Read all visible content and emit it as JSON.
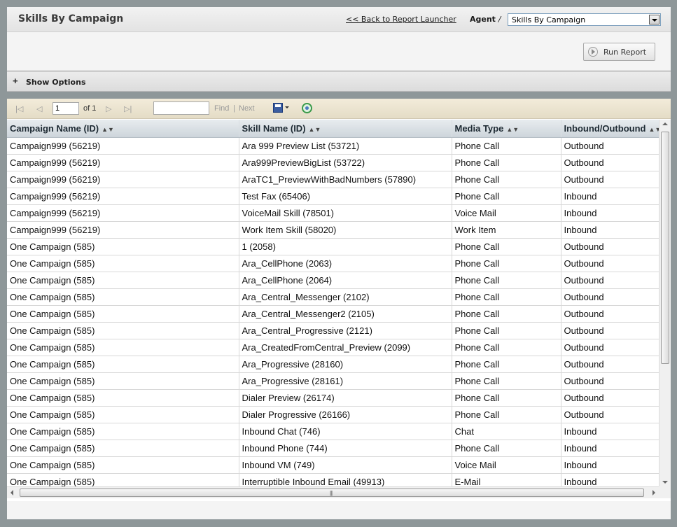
{
  "header": {
    "title": "Skills By Campaign",
    "back_link": "<< Back to Report Launcher",
    "agent_label": "Agent",
    "agent_sep": "/",
    "report_select": "Skills By Campaign"
  },
  "run_button": {
    "label": "Run Report"
  },
  "options": {
    "toggle": "+",
    "label": "Show Options"
  },
  "toolbar": {
    "page_value": "1",
    "of_label": "of 1",
    "find_label": "Find",
    "separator": "|",
    "next_label": "Next"
  },
  "table": {
    "columns": [
      "Campaign Name (ID)",
      "Skill Name (ID)",
      "Media Type",
      "Inbound/Outbound"
    ],
    "rows": [
      [
        "Campaign999 (56219)",
        "Ara 999 Preview List (53721)",
        "Phone Call",
        "Outbound"
      ],
      [
        "Campaign999 (56219)",
        "Ara999PreviewBigList (53722)",
        "Phone Call",
        "Outbound"
      ],
      [
        "Campaign999 (56219)",
        "AraTC1_PreviewWithBadNumbers (57890)",
        "Phone Call",
        "Outbound"
      ],
      [
        "Campaign999 (56219)",
        "Test Fax (65406)",
        "Phone Call",
        "Inbound"
      ],
      [
        "Campaign999 (56219)",
        "VoiceMail Skill (78501)",
        "Voice Mail",
        "Inbound"
      ],
      [
        "Campaign999 (56219)",
        "Work Item Skill (58020)",
        "Work Item",
        "Inbound"
      ],
      [
        "One Campaign (585)",
        "1 (2058)",
        "Phone Call",
        "Outbound"
      ],
      [
        "One Campaign (585)",
        "Ara_CellPhone (2063)",
        "Phone Call",
        "Outbound"
      ],
      [
        "One Campaign (585)",
        "Ara_CellPhone (2064)",
        "Phone Call",
        "Outbound"
      ],
      [
        "One Campaign (585)",
        "Ara_Central_Messenger (2102)",
        "Phone Call",
        "Outbound"
      ],
      [
        "One Campaign (585)",
        "Ara_Central_Messenger2 (2105)",
        "Phone Call",
        "Outbound"
      ],
      [
        "One Campaign (585)",
        "Ara_Central_Progressive (2121)",
        "Phone Call",
        "Outbound"
      ],
      [
        "One Campaign (585)",
        "Ara_CreatedFromCentral_Preview (2099)",
        "Phone Call",
        "Outbound"
      ],
      [
        "One Campaign (585)",
        "Ara_Progressive (28160)",
        "Phone Call",
        "Outbound"
      ],
      [
        "One Campaign (585)",
        "Ara_Progressive (28161)",
        "Phone Call",
        "Outbound"
      ],
      [
        "One Campaign (585)",
        "Dialer Preview (26174)",
        "Phone Call",
        "Outbound"
      ],
      [
        "One Campaign (585)",
        "Dialer Progressive  (26166)",
        "Phone Call",
        "Outbound"
      ],
      [
        "One Campaign (585)",
        "Inbound Chat (746)",
        "Chat",
        "Inbound"
      ],
      [
        "One Campaign (585)",
        "Inbound Phone (744)",
        "Phone Call",
        "Inbound"
      ],
      [
        "One Campaign (585)",
        "Inbound VM (749)",
        "Voice Mail",
        "Inbound"
      ],
      [
        "One Campaign (585)",
        "Interruptible Inbound Email (49913)",
        "E-Mail",
        "Inbound"
      ]
    ]
  }
}
